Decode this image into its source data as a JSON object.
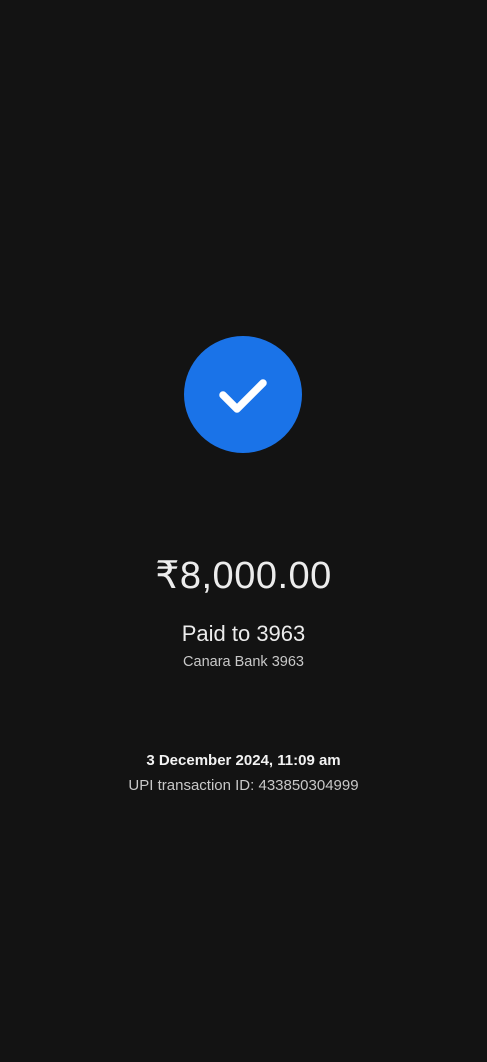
{
  "status": {
    "icon": "check-icon",
    "badge_color": "#1a73e8"
  },
  "payment": {
    "amount": "₹8,000.00",
    "paid_to": "Paid to 3963",
    "bank": "Canara Bank 3963"
  },
  "details": {
    "datetime": "3 December 2024, 11:09 am",
    "upi_transaction_id": "UPI transaction ID: 433850304999"
  }
}
